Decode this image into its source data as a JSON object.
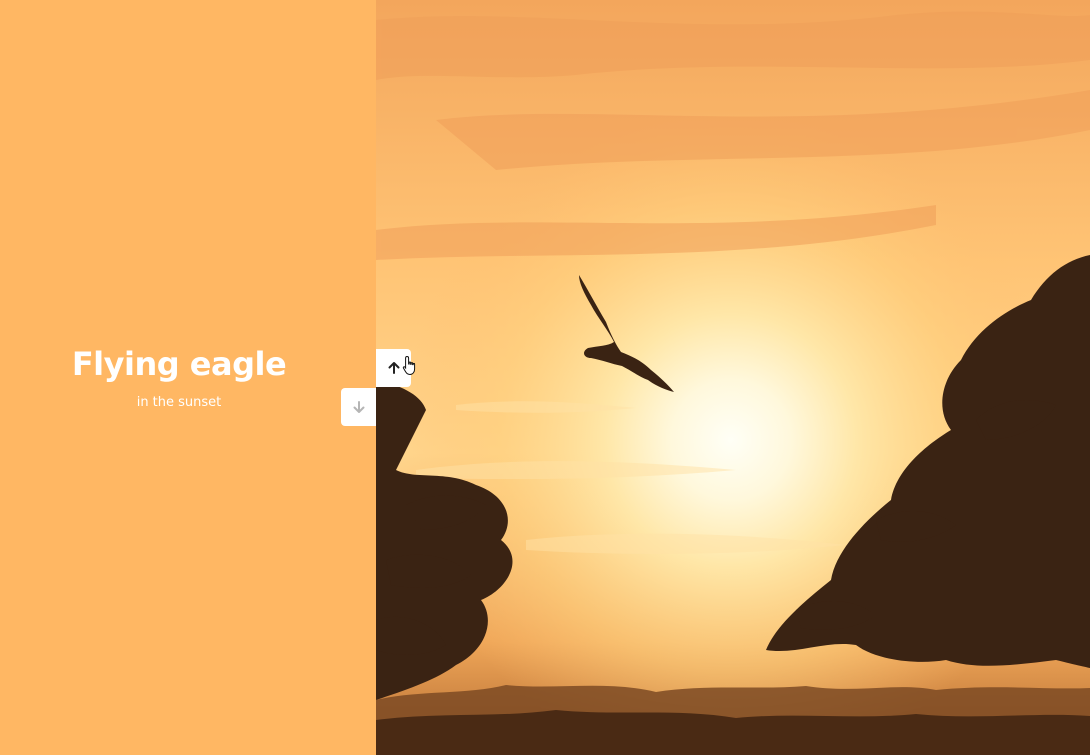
{
  "slide": {
    "title": "Flying eagle",
    "subtitle": "in the sunset"
  },
  "controls": {
    "up_icon": "arrow-up-icon",
    "down_icon": "arrow-down-icon"
  },
  "colors": {
    "panel": "#FFB763",
    "sky_top": "#F4A95E",
    "sun": "#FFFDF3",
    "silhouette": "#3A2313",
    "arrow_active": "#222222",
    "arrow_muted": "#B5B5B5"
  }
}
